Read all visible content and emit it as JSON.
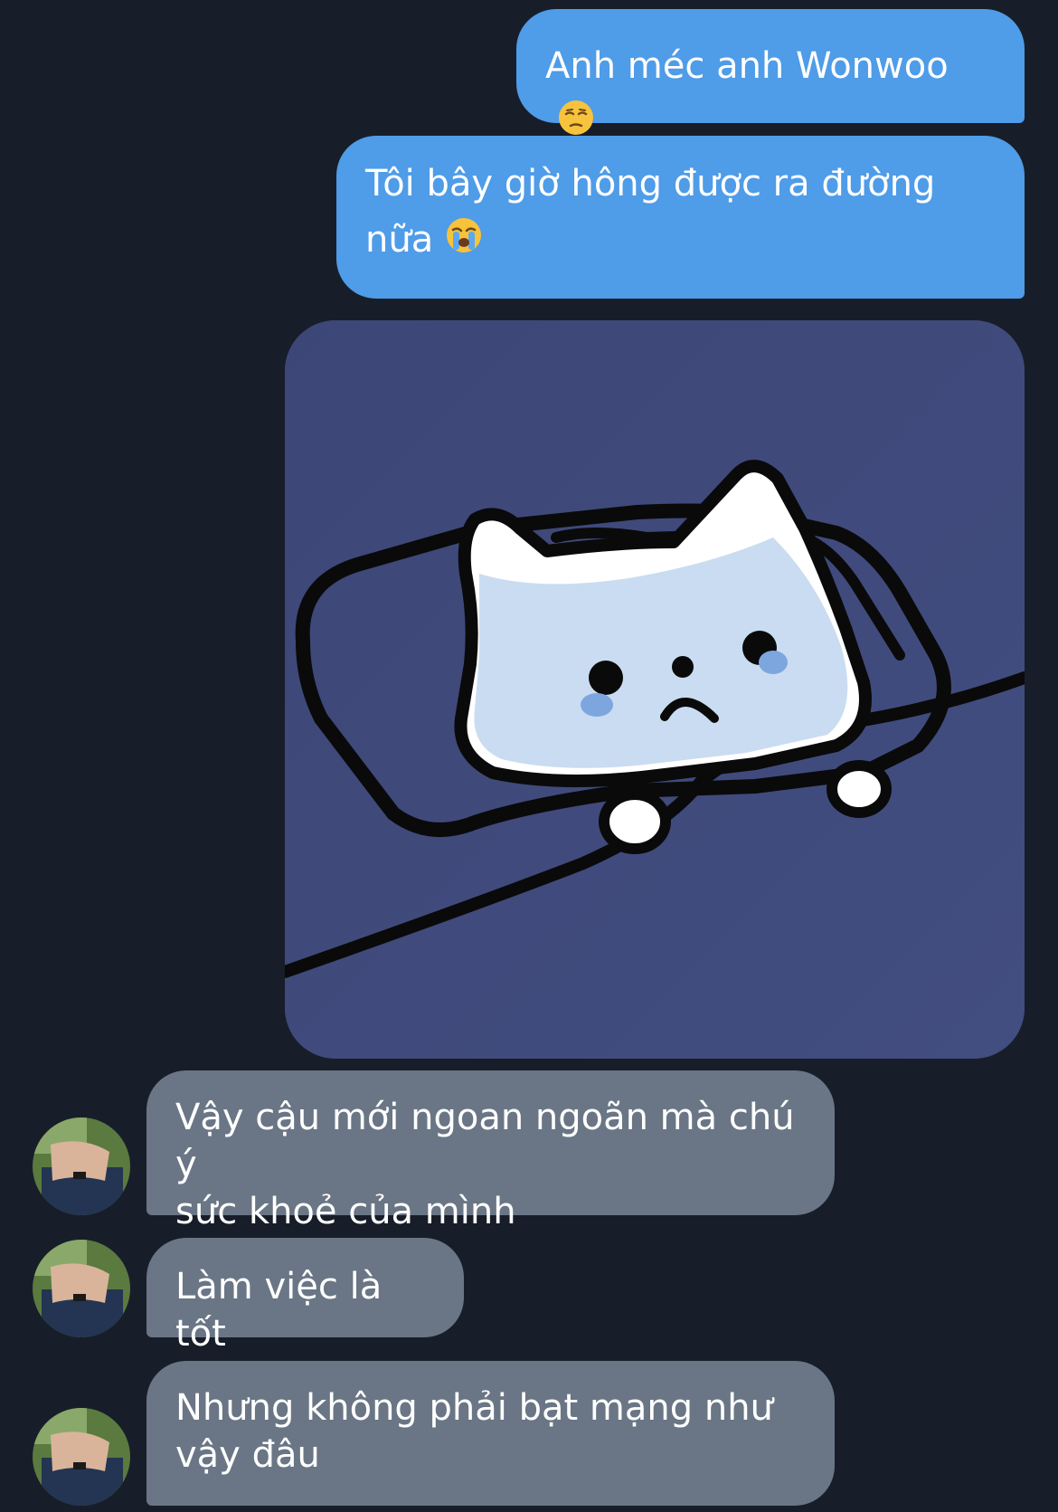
{
  "messages": [
    {
      "direction": "outgoing",
      "text": "Anh méc anh Wonwoo",
      "emoji": "unamused-face-icon"
    },
    {
      "direction": "outgoing",
      "text_line1": "Tôi bây giờ hông được ra đường",
      "text_line2": "nữa",
      "emoji": "crying-face-icon"
    },
    {
      "direction": "outgoing",
      "type": "image",
      "image": "sad-white-cat-on-pillow-sticker"
    },
    {
      "direction": "incoming",
      "text_line1": "Vậy cậu mới ngoan ngoãn mà chú ý",
      "text_line2": "sức khoẻ của mình"
    },
    {
      "direction": "incoming",
      "text": "Làm việc là tốt"
    },
    {
      "direction": "incoming",
      "text_line1": "Nhưng không phải bạt mạng như",
      "text_line2": "vậy đâu"
    }
  ],
  "colors": {
    "background": "#171e29",
    "outgoing_bubble": "#4f9ce8",
    "incoming_bubble": "#6a7685"
  }
}
